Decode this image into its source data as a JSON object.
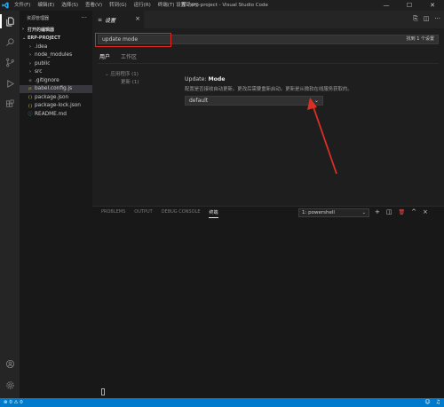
{
  "menu": [
    "文件(F)",
    "编辑(E)",
    "选择(S)",
    "查看(V)",
    "转到(G)",
    "运行(R)",
    "终端(T)",
    "帮助(H)"
  ],
  "window_title": "设置 - erp-project - Visual Studio Code",
  "window_controls": {
    "minimize": "—",
    "maximize": "☐",
    "close": "✕"
  },
  "sidebar": {
    "title": "资源管理器",
    "more": "···",
    "open_editors": "打开的编辑器",
    "project": "ERP-PROJECT",
    "items": [
      {
        "label": ".idea",
        "icon": "›"
      },
      {
        "label": "node_modules",
        "icon": "›"
      },
      {
        "label": "public",
        "icon": "›"
      },
      {
        "label": "src",
        "icon": "›"
      },
      {
        "label": ".gitignore",
        "icon": "◆"
      },
      {
        "label": "babel.config.js",
        "icon": "JS"
      },
      {
        "label": "package.json",
        "icon": "{}"
      },
      {
        "label": "package-lock.json",
        "icon": "{}"
      },
      {
        "label": "README.md",
        "icon": "ⓘ"
      }
    ]
  },
  "tab": {
    "label": "设置",
    "icon": "≡",
    "close": "×"
  },
  "settings": {
    "search_value": "update mode",
    "search_result": "找到 1 个设置",
    "scope_tabs": [
      "用户",
      "工作区"
    ],
    "toc": [
      {
        "label": "应用程序 (1)"
      },
      {
        "label": "更新 (1)"
      }
    ],
    "setting_prefix": "Update: ",
    "setting_name": "Mode",
    "setting_desc": "配置是否接收自动更新。更改后需要重新启动。更新是从微软在线服务获取的。",
    "select_value": "default",
    "select_chevron": "⌄"
  },
  "panel": {
    "tabs": [
      "PROBLEMS",
      "OUTPUT",
      "DEBUG CONSOLE",
      "终端"
    ],
    "terminal_select": "1: powershell",
    "actions": {
      "add": "+",
      "split": "◫",
      "trash": "🗑",
      "maximize": "^",
      "close": "×"
    }
  },
  "status": {
    "errors": "⊗ 0 ⚠ 0"
  },
  "colors": {
    "accent": "#007acc",
    "highlight_box": "#e0261f",
    "arrow": "#d93025"
  }
}
